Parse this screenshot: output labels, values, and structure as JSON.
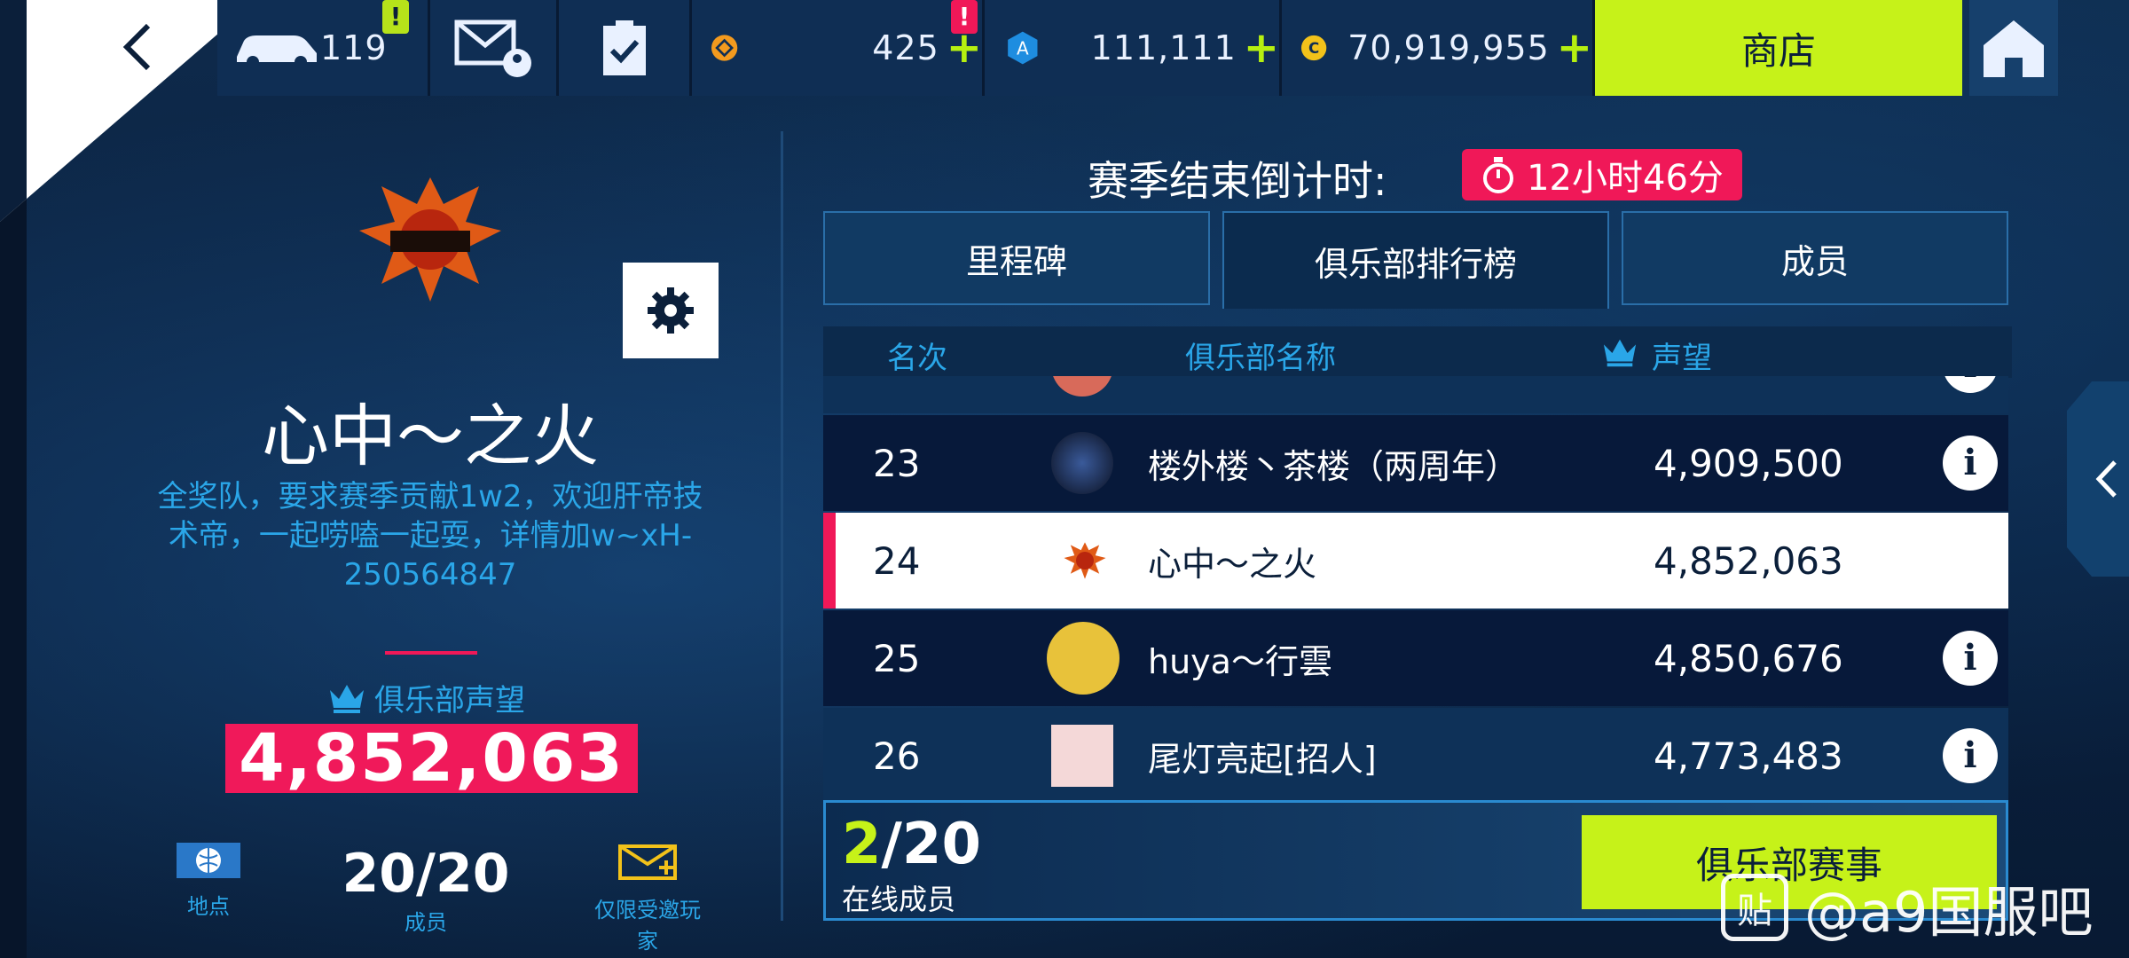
{
  "topbar": {
    "cars_count": "119",
    "cars_badge": "!",
    "currency1": "425",
    "currency1_badge": "!",
    "currency2": "111,111",
    "currency3": "70,919,955",
    "shop_label": "商店",
    "plus": "+"
  },
  "club": {
    "name": "心中～之火",
    "description": "全奖队，要求赛季贡献1w2，欢迎肝帝技术帝，一起唠嗑一起耍，详情加w~xH-250564847",
    "reputation_label": "俱乐部声望",
    "reputation_value": "4,852,063",
    "location_label": "地点",
    "members_value": "20/20",
    "members_label": "成员",
    "invite_label": "仅限受邀玩家"
  },
  "season": {
    "countdown_label": "赛季结束倒计时:",
    "countdown_value": "12小时46分"
  },
  "tabs": [
    "里程碑",
    "俱乐部排行榜",
    "成员"
  ],
  "leaderboard": {
    "col_rank": "名次",
    "col_name": "俱乐部名称",
    "col_score": "声望",
    "rows": [
      {
        "rank": "23",
        "name": "楼外楼丶茶楼（两周年）",
        "score": "4,909,500"
      },
      {
        "rank": "24",
        "name": "心中～之火",
        "score": "4,852,063"
      },
      {
        "rank": "25",
        "name": "huya～行雲",
        "score": "4,850,676"
      },
      {
        "rank": "26",
        "name": "尾灯亮起[招人]",
        "score": "4,773,483"
      }
    ]
  },
  "footer": {
    "online_num": "2",
    "online_total": "/20",
    "online_label": "在线成员",
    "events_button": "俱乐部赛事"
  },
  "watermark": "@a9国服吧",
  "colors": {
    "accent_green": "#c6f219",
    "accent_red": "#f01858",
    "accent_blue": "#2aa6e8"
  }
}
